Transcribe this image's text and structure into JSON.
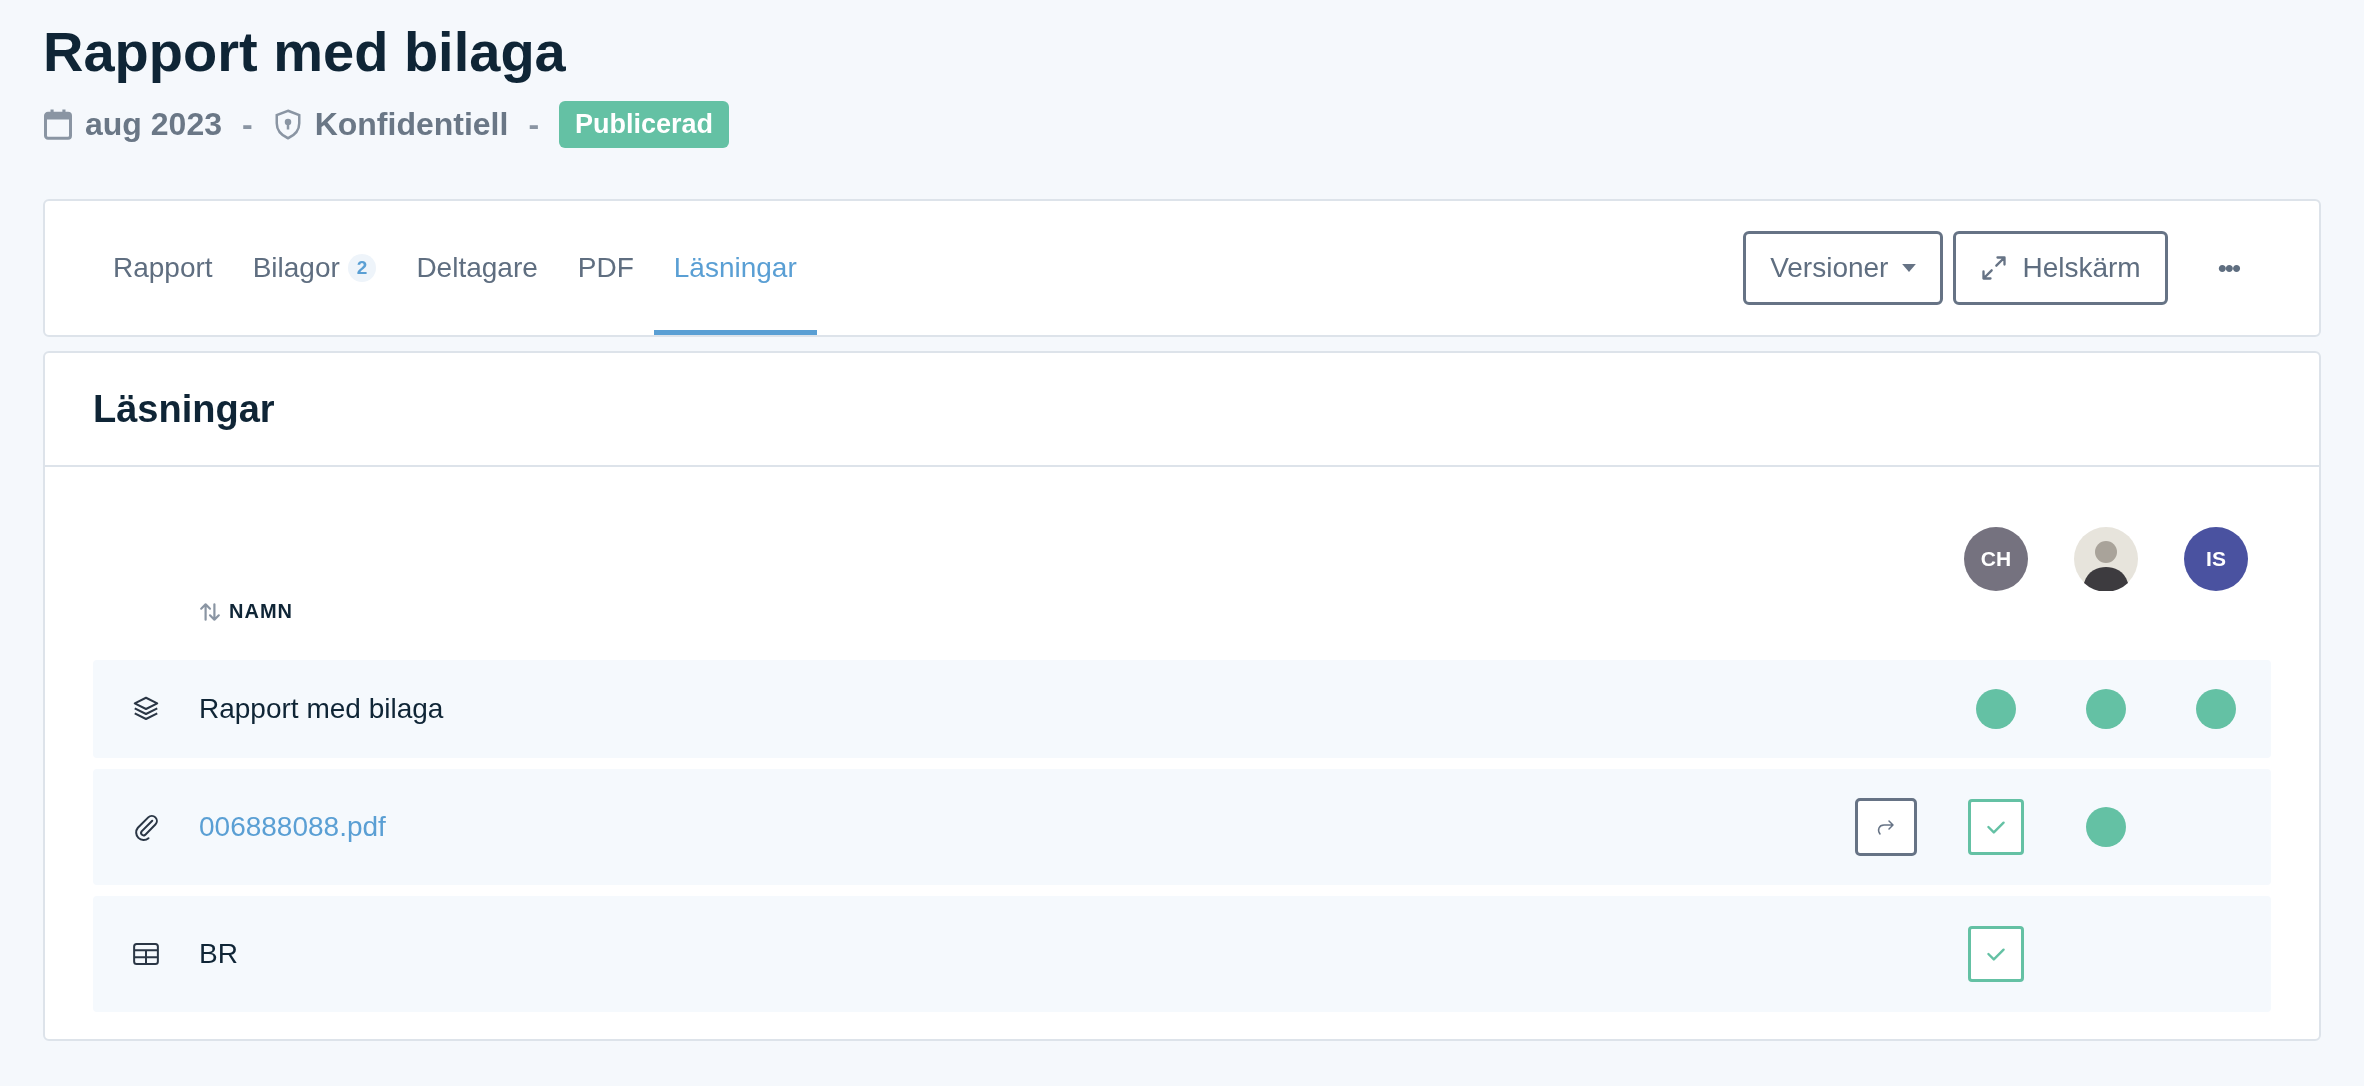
{
  "header": {
    "title": "Rapport med bilaga",
    "date": "aug 2023",
    "classification": "Konfidentiell",
    "separators": [
      "-",
      "-"
    ],
    "status": "Publicerad"
  },
  "tabs": [
    {
      "label": "Rapport",
      "selected": false
    },
    {
      "label": "Bilagor",
      "count": "2",
      "selected": false
    },
    {
      "label": "Deltagare",
      "selected": false
    },
    {
      "label": "PDF",
      "selected": false
    },
    {
      "label": "Läsningar",
      "selected": true
    }
  ],
  "toolbar": {
    "versions_button": "Versioner",
    "fullscreen_button": "Helskärm",
    "more_button": "•••"
  },
  "panel": {
    "title": "Läsningar",
    "table": {
      "name_column": "NAMN",
      "readers": [
        {
          "kind": "initials",
          "initials": "CH",
          "color": "#75727f"
        },
        {
          "kind": "photo"
        },
        {
          "kind": "initials",
          "initials": "IS",
          "color": "#4a52a0"
        }
      ],
      "rows": [
        {
          "kind": "bundle",
          "name": "Rapport med bilaga",
          "forward": false,
          "cells": [
            {
              "kind": "dot"
            },
            {
              "kind": "dot"
            },
            {
              "kind": "dot"
            }
          ]
        },
        {
          "kind": "attachment",
          "name": "006888088.pdf",
          "forward": true,
          "cells": [
            {
              "kind": "check"
            },
            {
              "kind": "dot"
            },
            {
              "kind": "empty"
            }
          ]
        },
        {
          "kind": "table",
          "name": "BR",
          "forward": false,
          "cells": [
            {
              "kind": "check"
            },
            {
              "kind": "empty"
            },
            {
              "kind": "empty"
            }
          ]
        }
      ]
    }
  }
}
